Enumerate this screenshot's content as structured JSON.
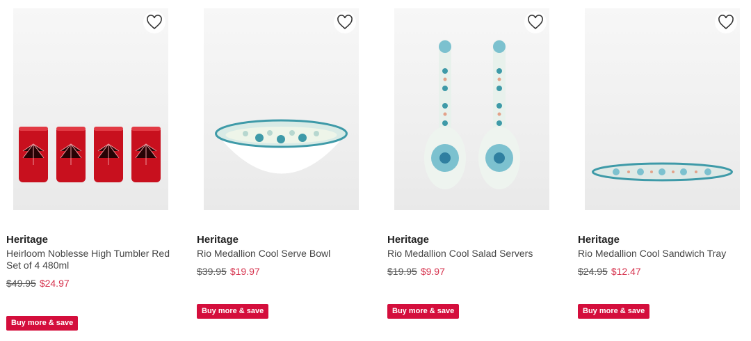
{
  "products": [
    {
      "brand": "Heritage",
      "title": "Heirloom Noblesse High Tumbler Red Set of 4 480ml",
      "was_price": "$49.95",
      "now_price": "$24.97",
      "promo": "Buy more & save",
      "image": "red-tumblers-image"
    },
    {
      "brand": "Heritage",
      "title": "Rio Medallion Cool Serve Bowl",
      "was_price": "$39.95",
      "now_price": "$19.97",
      "promo": "Buy more & save",
      "image": "serve-bowl-image"
    },
    {
      "brand": "Heritage",
      "title": "Rio Medallion Cool Salad Servers",
      "was_price": "$19.95",
      "now_price": "$9.97",
      "promo": "Buy more & save",
      "image": "salad-servers-image"
    },
    {
      "brand": "Heritage",
      "title": "Rio Medallion Cool Sandwich Tray",
      "was_price": "$24.95",
      "now_price": "$12.47",
      "promo": "Buy more & save",
      "image": "sandwich-tray-image"
    }
  ],
  "colors": {
    "sale": "#d6334e",
    "promo_bg": "#d40e3c",
    "text": "#222222"
  }
}
